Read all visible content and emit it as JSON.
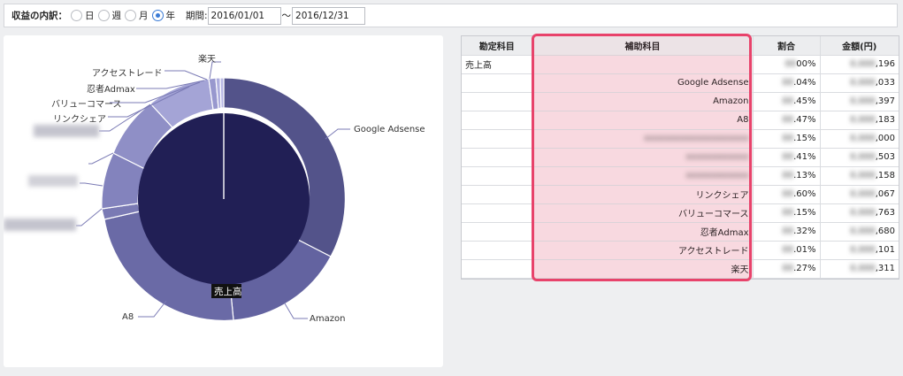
{
  "filter": {
    "label": "収益の内訳：",
    "options": [
      {
        "label": "日",
        "selected": false
      },
      {
        "label": "週",
        "selected": false
      },
      {
        "label": "月",
        "selected": false
      },
      {
        "label": "年",
        "selected": true
      }
    ],
    "period_label": "期間:",
    "start_date": "2016/01/01",
    "range_sep": "〜",
    "end_date": "2016/12/31"
  },
  "chart": {
    "center_label": "売上高",
    "outer_labels": [
      "Google Adsense",
      "Amazon",
      "A8",
      "リンクシェア",
      "バリューコマース",
      "忍者Admax",
      "アクセストレード",
      "楽天"
    ],
    "colors": {
      "inner": "#211f55",
      "outer_dark": "#53538a",
      "outer_mid": "#6a6aa6",
      "outer_light": "#8f8fc6",
      "outer_lighter": "#a4a4d6",
      "leader": "#7b7bb5"
    }
  },
  "table": {
    "headers": {
      "account": "勘定科目",
      "sub": "補助科目",
      "ratio": "割合",
      "amount": "金額(円)"
    },
    "rows": [
      {
        "account": "売上高",
        "sub": "",
        "ratio": "00%",
        "amount": ",196"
      },
      {
        "account": "",
        "sub": "Google Adsense",
        "ratio": ".04%",
        "amount": ",033"
      },
      {
        "account": "",
        "sub": "Amazon",
        "ratio": ".45%",
        "amount": ",397"
      },
      {
        "account": "",
        "sub": "A8",
        "ratio": ".47%",
        "amount": ",183"
      },
      {
        "account": "",
        "sub": "",
        "ratio": ".15%",
        "amount": ",000"
      },
      {
        "account": "",
        "sub": "",
        "ratio": ".41%",
        "amount": ",503"
      },
      {
        "account": "",
        "sub": "",
        "ratio": ".13%",
        "amount": ",158"
      },
      {
        "account": "",
        "sub": "リンクシェア",
        "ratio": ".60%",
        "amount": ",067"
      },
      {
        "account": "",
        "sub": "バリューコマース",
        "ratio": ".15%",
        "amount": ",763"
      },
      {
        "account": "",
        "sub": "忍者Admax",
        "ratio": ".32%",
        "amount": ",680"
      },
      {
        "account": "",
        "sub": "アクセストレード",
        "ratio": ".01%",
        "amount": ",101"
      },
      {
        "account": "",
        "sub": "楽天",
        "ratio": ".27%",
        "amount": ",311"
      }
    ]
  }
}
